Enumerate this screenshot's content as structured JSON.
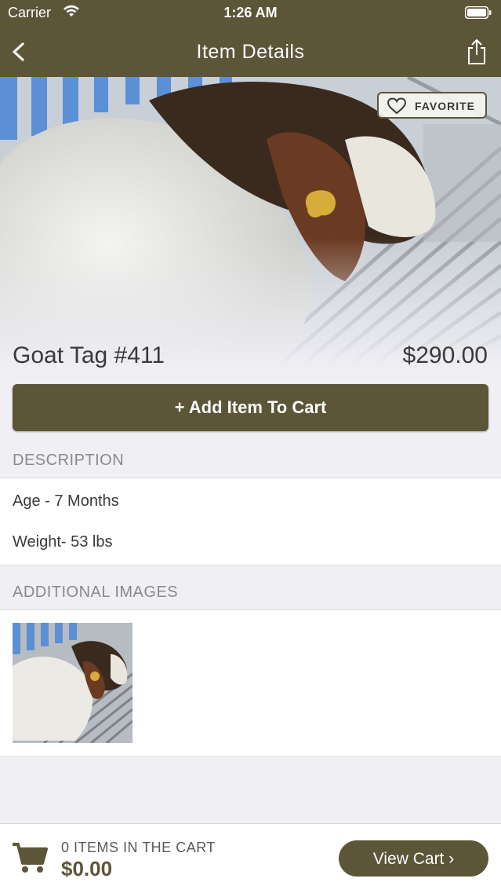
{
  "status_bar": {
    "carrier": "Carrier",
    "time": "1:26 AM"
  },
  "nav": {
    "title": "Item Details",
    "back_icon": "chevron-left-icon",
    "share_icon": "share-icon"
  },
  "item": {
    "name": "Goat Tag #411",
    "price": "$290.00",
    "favorite_label": "FAVORITE",
    "add_to_cart_label": "Add Item To Cart"
  },
  "description": {
    "header": "DESCRIPTION",
    "lines": [
      "Age - 7 Months",
      "Weight- 53 lbs"
    ]
  },
  "additional_images": {
    "header": "ADDITIONAL IMAGES",
    "count": 1
  },
  "cart": {
    "items_text": "0 ITEMS IN THE CART",
    "total": "$0.00",
    "view_cart_label": "View Cart ›"
  },
  "colors": {
    "brand": "#5c5538",
    "background": "#efeff4",
    "text": "#3a3a3a",
    "muted": "#8a8a8a"
  }
}
